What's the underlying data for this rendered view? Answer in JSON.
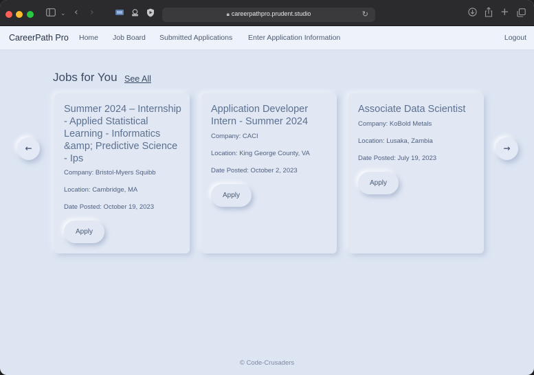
{
  "browser": {
    "url": "careerpathpro.prudent.studio",
    "icons": [
      "sidebar-icon",
      "chevron-down-icon",
      "back-icon",
      "forward-icon",
      "tab-overview-icon",
      "privacy-icon",
      "shield-icon",
      "reload-icon",
      "download-icon",
      "share-icon",
      "new-tab-icon",
      "tabs-icon"
    ]
  },
  "navbar": {
    "brand": "CareerPath Pro",
    "links": [
      "Home",
      "Job Board",
      "Submitted Applications",
      "Enter Application Information"
    ],
    "logout": "Logout"
  },
  "section": {
    "title": "Jobs for You",
    "see_all": "See All"
  },
  "jobs": [
    {
      "title": "Summer 2024 – Internship - Applied Statistical Learning - Informatics &amp; Predictive Science - Ips",
      "company": "Company: Bristol-Myers Squibb",
      "location": "Location: Cambridge, MA",
      "date": "Date Posted: October 19, 2023",
      "apply": "Apply"
    },
    {
      "title": "Application Developer Intern - Summer 2024",
      "company": "Company: CACI",
      "location": "Location: King George County, VA",
      "date": "Date Posted: October 2, 2023",
      "apply": "Apply"
    },
    {
      "title": "Associate Data Scientist",
      "company": "Company: KoBold Metals",
      "location": "Location: Lusaka, Zambia",
      "date": "Date Posted: July 19, 2023",
      "apply": "Apply"
    }
  ],
  "carousel": {
    "prev_glyph": "←",
    "next_glyph": "→"
  },
  "footer": "© Code-Crusaders",
  "colors": {
    "page_bg": "#dde5f3",
    "navbar_bg": "#eef3fb",
    "card_title": "#5b7090",
    "text": "#4f6080"
  }
}
